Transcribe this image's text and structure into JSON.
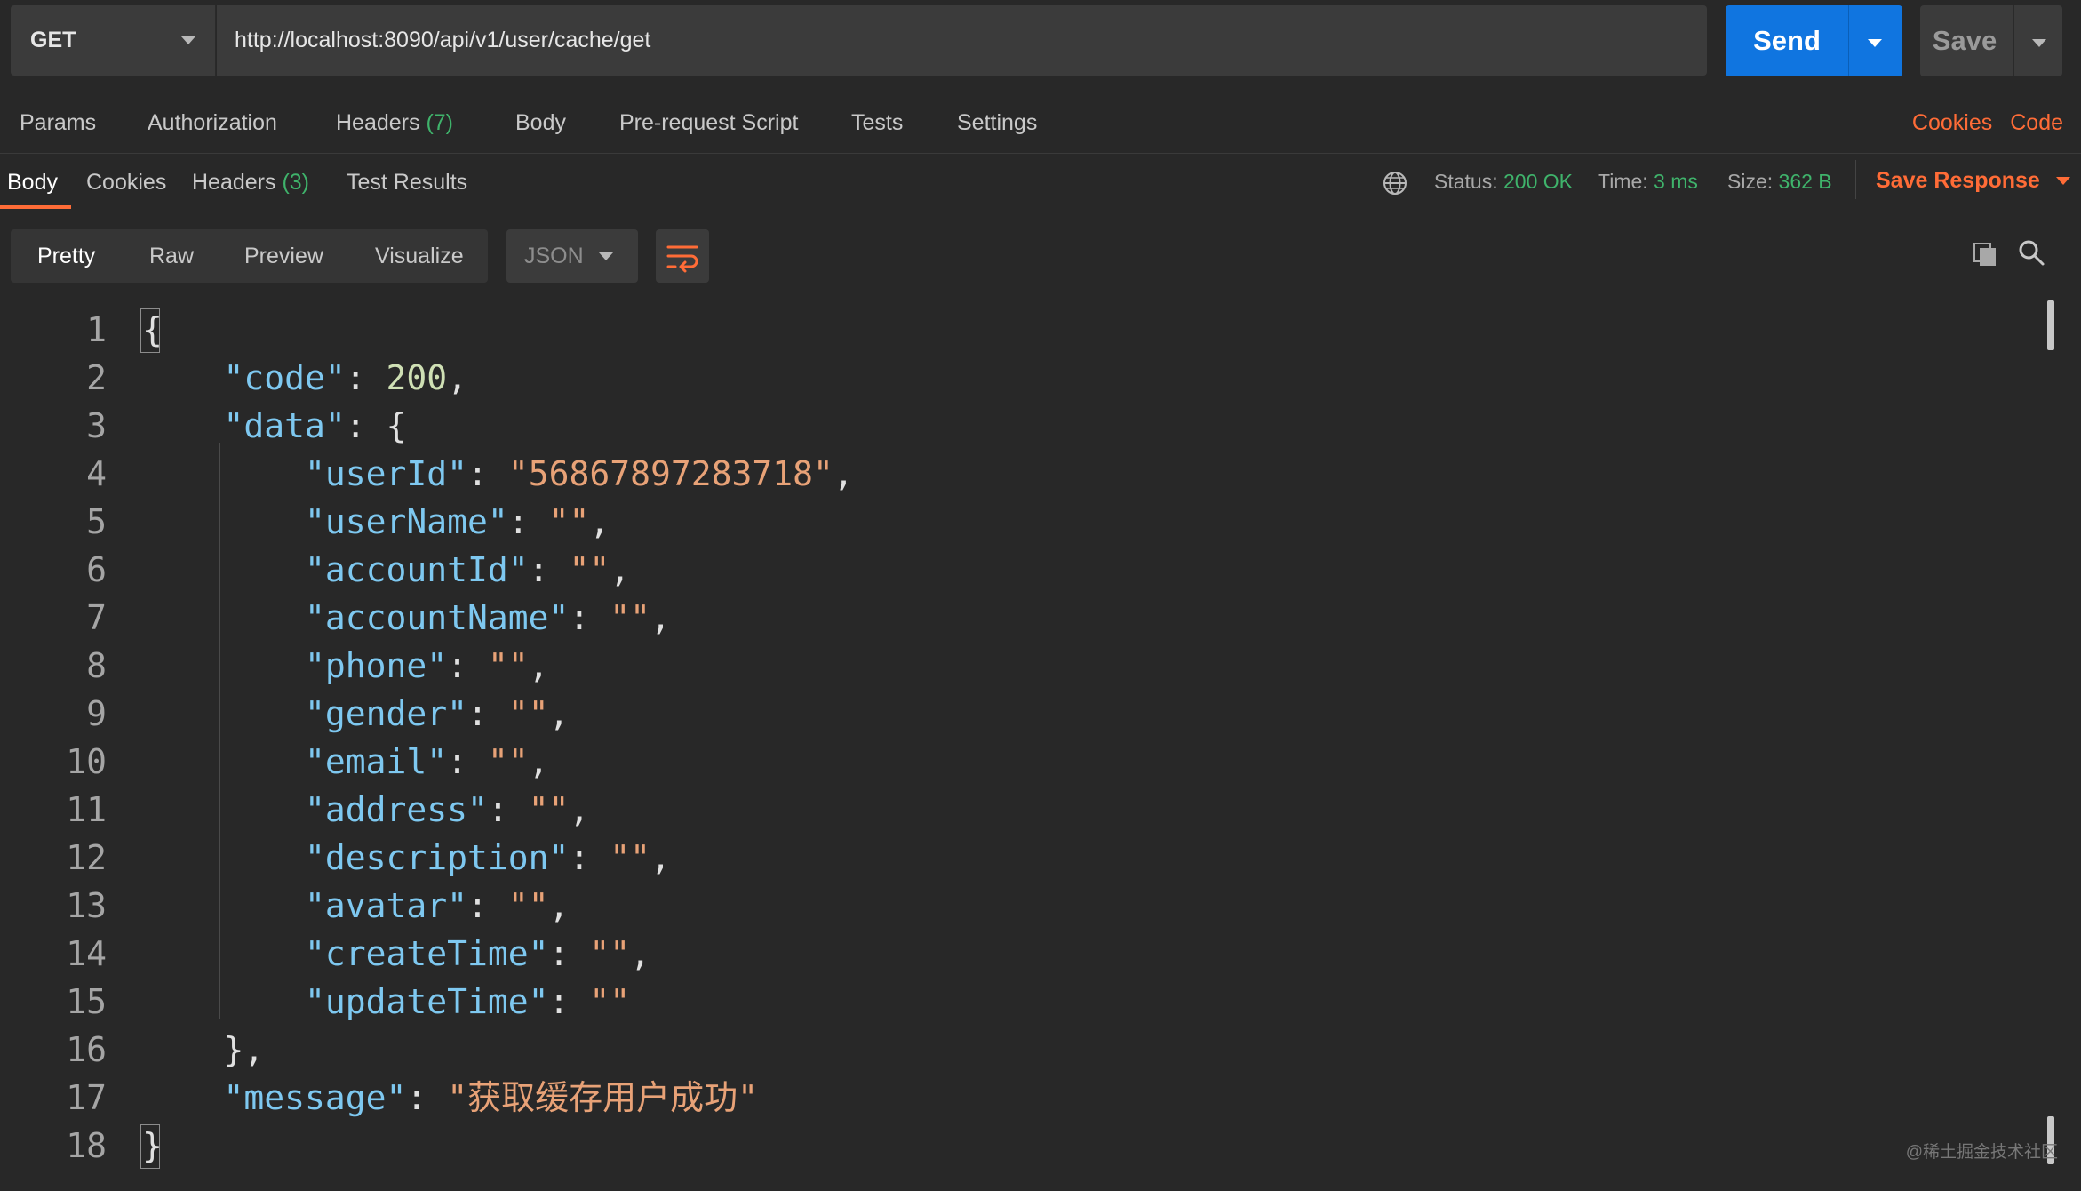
{
  "request": {
    "method": "GET",
    "url": "http://localhost:8090/api/v1/user/cache/get",
    "send_label": "Send",
    "save_label": "Save"
  },
  "request_tabs": {
    "params": "Params",
    "authorization": "Authorization",
    "headers": "Headers",
    "headers_count": "(7)",
    "body": "Body",
    "pre_request": "Pre-request Script",
    "tests": "Tests",
    "settings": "Settings",
    "cookies_link": "Cookies",
    "code_link": "Code"
  },
  "response_tabs": {
    "body": "Body",
    "cookies": "Cookies",
    "headers": "Headers",
    "headers_count": "(3)",
    "test_results": "Test Results"
  },
  "response_meta": {
    "status_label": "Status:",
    "status_value": "200 OK",
    "time_label": "Time:",
    "time_value": "3 ms",
    "size_label": "Size:",
    "size_value": "362 B",
    "save_response": "Save Response"
  },
  "view": {
    "pretty": "Pretty",
    "raw": "Raw",
    "preview": "Preview",
    "visualize": "Visualize",
    "format": "JSON"
  },
  "code": {
    "line_numbers": [
      "1",
      "2",
      "3",
      "4",
      "5",
      "6",
      "7",
      "8",
      "9",
      "10",
      "11",
      "12",
      "13",
      "14",
      "15",
      "16",
      "17",
      "18"
    ],
    "lines": [
      [
        {
          "t": "p",
          "v": "{"
        }
      ],
      [
        {
          "t": "k",
          "v": "    \"code\""
        },
        {
          "t": "p",
          "v": ": "
        },
        {
          "t": "n",
          "v": "200"
        },
        {
          "t": "p",
          "v": ","
        }
      ],
      [
        {
          "t": "k",
          "v": "    \"data\""
        },
        {
          "t": "p",
          "v": ": {"
        }
      ],
      [
        {
          "t": "k",
          "v": "        \"userId\""
        },
        {
          "t": "p",
          "v": ": "
        },
        {
          "t": "s",
          "v": "\"56867897283718\""
        },
        {
          "t": "p",
          "v": ","
        }
      ],
      [
        {
          "t": "k",
          "v": "        \"userName\""
        },
        {
          "t": "p",
          "v": ": "
        },
        {
          "t": "s",
          "v": "\"\""
        },
        {
          "t": "p",
          "v": ","
        }
      ],
      [
        {
          "t": "k",
          "v": "        \"accountId\""
        },
        {
          "t": "p",
          "v": ": "
        },
        {
          "t": "s",
          "v": "\"\""
        },
        {
          "t": "p",
          "v": ","
        }
      ],
      [
        {
          "t": "k",
          "v": "        \"accountName\""
        },
        {
          "t": "p",
          "v": ": "
        },
        {
          "t": "s",
          "v": "\"\""
        },
        {
          "t": "p",
          "v": ","
        }
      ],
      [
        {
          "t": "k",
          "v": "        \"phone\""
        },
        {
          "t": "p",
          "v": ": "
        },
        {
          "t": "s",
          "v": "\"\""
        },
        {
          "t": "p",
          "v": ","
        }
      ],
      [
        {
          "t": "k",
          "v": "        \"gender\""
        },
        {
          "t": "p",
          "v": ": "
        },
        {
          "t": "s",
          "v": "\"\""
        },
        {
          "t": "p",
          "v": ","
        }
      ],
      [
        {
          "t": "k",
          "v": "        \"email\""
        },
        {
          "t": "p",
          "v": ": "
        },
        {
          "t": "s",
          "v": "\"\""
        },
        {
          "t": "p",
          "v": ","
        }
      ],
      [
        {
          "t": "k",
          "v": "        \"address\""
        },
        {
          "t": "p",
          "v": ": "
        },
        {
          "t": "s",
          "v": "\"\""
        },
        {
          "t": "p",
          "v": ","
        }
      ],
      [
        {
          "t": "k",
          "v": "        \"description\""
        },
        {
          "t": "p",
          "v": ": "
        },
        {
          "t": "s",
          "v": "\"\""
        },
        {
          "t": "p",
          "v": ","
        }
      ],
      [
        {
          "t": "k",
          "v": "        \"avatar\""
        },
        {
          "t": "p",
          "v": ": "
        },
        {
          "t": "s",
          "v": "\"\""
        },
        {
          "t": "p",
          "v": ","
        }
      ],
      [
        {
          "t": "k",
          "v": "        \"createTime\""
        },
        {
          "t": "p",
          "v": ": "
        },
        {
          "t": "s",
          "v": "\"\""
        },
        {
          "t": "p",
          "v": ","
        }
      ],
      [
        {
          "t": "k",
          "v": "        \"updateTime\""
        },
        {
          "t": "p",
          "v": ": "
        },
        {
          "t": "s",
          "v": "\"\""
        }
      ],
      [
        {
          "t": "p",
          "v": "    },"
        }
      ],
      [
        {
          "t": "k",
          "v": "    \"message\""
        },
        {
          "t": "p",
          "v": ": "
        },
        {
          "t": "s",
          "v": "\"获取缓存用户成功\""
        }
      ],
      [
        {
          "t": "p",
          "v": "}"
        }
      ]
    ]
  },
  "watermark": "@稀土掘金技术社区",
  "colors": {
    "accent": "#ff6c37",
    "send": "#1075e0",
    "success": "#3fb36b",
    "json_key": "#7ec8f0",
    "json_string": "#e8a277",
    "json_number": "#cfe0b4"
  }
}
